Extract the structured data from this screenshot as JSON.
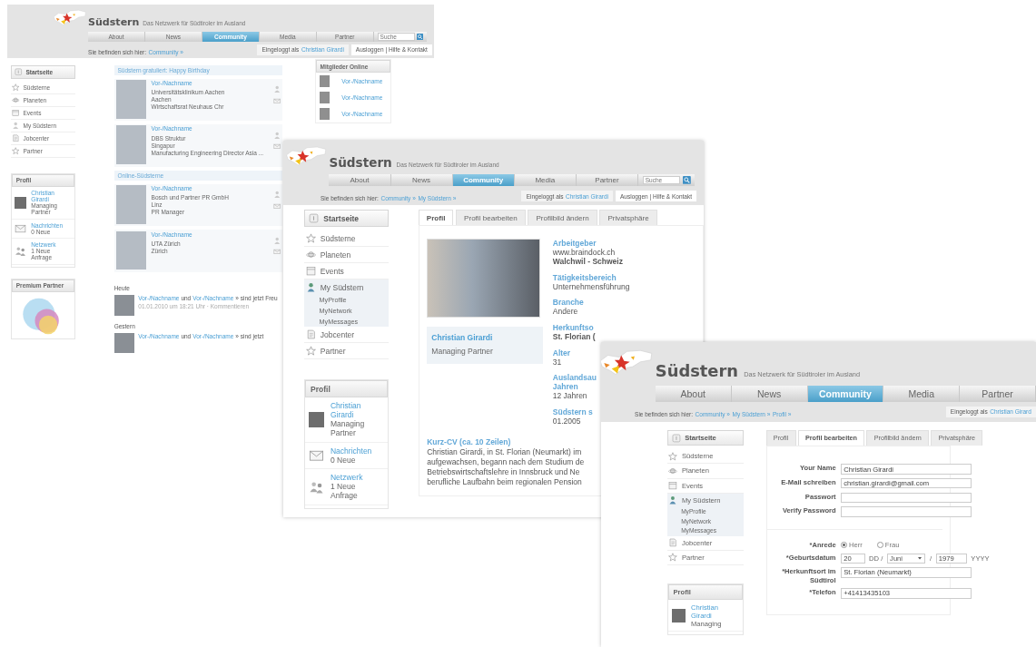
{
  "windows": [
    {
      "kind": "dashboard",
      "header": {
        "brand": "Südstern",
        "tagline": "Das Netzwerk für Südtiroler im Ausland"
      },
      "nav": [
        {
          "label": "About",
          "selected": false
        },
        {
          "label": "News",
          "selected": false
        },
        {
          "label": "Community",
          "selected": true
        },
        {
          "label": "Media",
          "selected": false
        },
        {
          "label": "Partner",
          "selected": false
        }
      ],
      "search": {
        "placeholder": "Suche"
      },
      "breadcrumb": {
        "prefix": "Sie befinden sich hier:",
        "links": [
          "Community »"
        ]
      },
      "login": {
        "prefix": "Eingeloggt als",
        "user": "Christian Girardi",
        "account_links": "Ausloggen | Hilfe & Kontakt"
      },
      "sidebar": {
        "home": "Startseite",
        "items": [
          {
            "label": "Südsterne",
            "selected": false
          },
          {
            "label": "Planeten",
            "selected": false
          },
          {
            "label": "Events",
            "selected": false
          },
          {
            "label": "My Südstern",
            "selected": false
          },
          {
            "label": "Jobcenter",
            "selected": false
          },
          {
            "label": "Partner",
            "selected": false
          }
        ]
      },
      "profile_box": {
        "title": "Profil",
        "entries": [
          {
            "link": "Christian Girardi",
            "lines": [
              "Managing Partner"
            ]
          },
          {
            "link": "Nachrichten",
            "lines": [
              "0 Neue"
            ]
          },
          {
            "link": "Netzwerk",
            "lines": [
              "1 Neue Anfrage"
            ]
          }
        ]
      },
      "premium": {
        "title": "Premium Partner"
      },
      "member_groups": [
        {
          "title": "Südstern gratuliert: Happy Birthday",
          "members": [
            {
              "name": "Vor-/Nachname",
              "lines": [
                "Universitätsklinikum Aachen",
                "Aachen",
                "Wirtschaftsrat Neuhaus Chr"
              ]
            },
            {
              "name": "Vor-/Nachname",
              "lines": [
                "DBS Struktur",
                "Singapur",
                "Manufacturing Engineering Director Asia ..."
              ]
            }
          ]
        },
        {
          "title": "Online-Südsterne",
          "members": [
            {
              "name": "Vor-/Nachname",
              "lines": [
                "Bosch und Partner PR GmbH",
                "Linz",
                "PR Manager"
              ]
            },
            {
              "name": "Vor-/Nachname",
              "lines": [
                "UTA Zürich",
                "Zürich"
              ]
            }
          ]
        }
      ],
      "activity": [
        {
          "day": "Heute",
          "links": [
            "Vor-/Nachname",
            "Vor-/Nachname"
          ],
          "joiner": "und",
          "text": "» sind jetzt Freu",
          "meta": "01.01.2010 um 18:21 Uhr · Kommentieren"
        },
        {
          "day": "Gestern",
          "links": [
            "Vor-/Nachname",
            "Vor-/Nachname"
          ],
          "joiner": "und",
          "text": "» sind jetzt"
        }
      ],
      "online_box": {
        "title": "Mitglieder Online",
        "members": [
          "Vor-/Nachname",
          "Vor-/Nachname",
          "Vor-/Nachname"
        ]
      }
    },
    {
      "kind": "profile",
      "header": {
        "brand": "Südstern",
        "tagline": "Das Netzwerk für Südtiroler im Ausland"
      },
      "nav": [
        {
          "label": "About",
          "selected": false
        },
        {
          "label": "News",
          "selected": false
        },
        {
          "label": "Community",
          "selected": true
        },
        {
          "label": "Media",
          "selected": false
        },
        {
          "label": "Partner",
          "selected": false
        }
      ],
      "search": {
        "placeholder": "Suche"
      },
      "breadcrumb": {
        "prefix": "Sie befinden sich hier:",
        "links": [
          "Community »",
          "My Südstern »"
        ]
      },
      "login": {
        "prefix": "Eingeloggt als",
        "user": "Christian Girardi",
        "account_links": "Ausloggen | Hilfe & Kontakt"
      },
      "sidebar": {
        "home": "Startseite",
        "items": [
          {
            "label": "Südsterne",
            "selected": false
          },
          {
            "label": "Planeten",
            "selected": false
          },
          {
            "label": "Events",
            "selected": false
          },
          {
            "label": "My Südstern",
            "selected": true,
            "children": [
              "MyProfile",
              "MyNetwork",
              "MyMessages"
            ]
          },
          {
            "label": "Jobcenter",
            "selected": false
          },
          {
            "label": "Partner",
            "selected": false
          }
        ]
      },
      "profile_box": {
        "title": "Profil",
        "entries": [
          {
            "link": "Christian Girardi",
            "lines": [
              "Managing Partner"
            ]
          },
          {
            "link": "Nachrichten",
            "lines": [
              "0 Neue"
            ]
          },
          {
            "link": "Netzwerk",
            "lines": [
              "1 Neue Anfrage"
            ]
          }
        ]
      },
      "tabs": [
        {
          "label": "Profil",
          "selected": true
        },
        {
          "label": "Profil bearbeiten",
          "selected": false
        },
        {
          "label": "Profilbild ändern",
          "selected": false
        },
        {
          "label": "Privatsphäre",
          "selected": false
        }
      ],
      "person": {
        "name": "Christian Girardi",
        "role": "Managing Partner"
      },
      "facts": [
        {
          "label": "Arbeitgeber",
          "values": [
            {
              "text": "www.braindock.ch",
              "bold": false
            },
            {
              "text": "Walchwil - Schweiz",
              "bold": true
            }
          ]
        },
        {
          "label": "Tätigkeitsbereich",
          "values": [
            {
              "text": "Unternehmensführung",
              "bold": false
            }
          ]
        },
        {
          "label": "Branche",
          "values": [
            {
              "text": "Andere",
              "bold": false
            }
          ]
        },
        {
          "label": "Herkunftso",
          "values": [
            {
              "text": "St. Florian (",
              "bold": true
            }
          ]
        },
        {
          "label": "Alter",
          "values": [
            {
              "text": "31",
              "bold": false
            }
          ]
        },
        {
          "label": "Auslandsau\nJahren",
          "values": [
            {
              "text": "12 Jahren",
              "bold": false
            }
          ]
        },
        {
          "label": "Südstern s",
          "values": [
            {
              "text": "01.2005",
              "bold": false
            }
          ]
        }
      ],
      "cv": {
        "title": "Kurz-CV (ca. 10 Zeilen)",
        "text": "Christian Girardi, in St. Florian (Neumarkt) im\naufgewachsen, begann nach dem Studium de\nBetriebswirtschaftslehre in Innsbruck und Ne\nberufliche Laufbahn beim regionalen Pension"
      }
    },
    {
      "kind": "edit",
      "header": {
        "brand": "Südstern",
        "tagline": "Das Netzwerk für Südtiroler im Ausland"
      },
      "nav": [
        {
          "label": "About",
          "selected": false
        },
        {
          "label": "News",
          "selected": false
        },
        {
          "label": "Community",
          "selected": true
        },
        {
          "label": "Media",
          "selected": false
        },
        {
          "label": "Partner",
          "selected": false
        }
      ],
      "breadcrumb": {
        "prefix": "Sie befinden sich hier:",
        "links": [
          "Community »",
          "My Südstern »",
          "Profil »"
        ]
      },
      "login": {
        "prefix": "Eingeloggt als",
        "user": "Christian Girard"
      },
      "sidebar": {
        "home": "Startseite",
        "items": [
          {
            "label": "Südsterne",
            "selected": false
          },
          {
            "label": "Planeten",
            "selected": false
          },
          {
            "label": "Events",
            "selected": false
          },
          {
            "label": "My Südstern",
            "selected": true,
            "children": [
              "MyProfile",
              "MyNetwork",
              "MyMessages"
            ]
          },
          {
            "label": "Jobcenter",
            "selected": false
          },
          {
            "label": "Partner",
            "selected": false
          }
        ]
      },
      "profile_box": {
        "title": "Profil",
        "entries": [
          {
            "link": "Christian Girardi",
            "lines": [
              "Managing"
            ]
          }
        ]
      },
      "tabs": [
        {
          "label": "Profil",
          "selected": false
        },
        {
          "label": "Profil bearbeiten",
          "selected": true
        },
        {
          "label": "Profilbild ändern",
          "selected": false
        },
        {
          "label": "Privatsphäre",
          "selected": false
        }
      ],
      "form_sections": [
        [
          {
            "kind": "text",
            "label": "Your Name",
            "value": "Christian Girardi"
          },
          {
            "kind": "text",
            "label": "E-Mail schreiben",
            "value": "christian.girardi@gmail.com"
          },
          {
            "kind": "password",
            "label": "Passwort"
          },
          {
            "kind": "password",
            "label": "Verify Password"
          }
        ],
        [
          {
            "kind": "radio",
            "label": "*Anrede",
            "options": [
              {
                "label": "Herr",
                "selected": true
              },
              {
                "label": "Frau",
                "selected": false
              }
            ]
          },
          {
            "kind": "date",
            "label": "*Geburtsdatum",
            "day": "20",
            "day_hint": "DD /",
            "month": "Juni",
            "separator": "/",
            "year": "1979",
            "year_hint": "YYYY"
          },
          {
            "kind": "text",
            "label": "*Herkunftsort im Südtirol",
            "value": "St. Florian (Neumarkt)"
          },
          {
            "kind": "text",
            "label": "*Telefon",
            "value": "+41413435103"
          }
        ]
      ]
    }
  ]
}
